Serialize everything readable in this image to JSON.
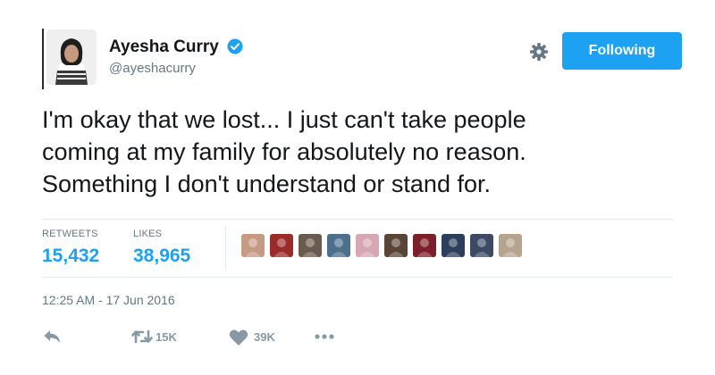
{
  "user": {
    "display_name": "Ayesha Curry",
    "handle": "@ayeshacurry",
    "verified": true,
    "avatar_icon": "profile-photo"
  },
  "follow_button": {
    "label": "Following",
    "color": "#1da1f2"
  },
  "settings": {
    "icon": "gear-icon"
  },
  "tweet": {
    "lines": [
      "I'm okay that we lost... I just can't take people",
      "coming at my family for absolutely no reason.",
      "Something I don't understand or stand for."
    ]
  },
  "stats": {
    "retweets_label": "RETWEETS",
    "retweets_value": "15,432",
    "likes_label": "LIKES",
    "likes_value": "38,965"
  },
  "likers": [
    {
      "name": "liker-avatar-1",
      "color": "#c79a86"
    },
    {
      "name": "liker-avatar-2",
      "color": "#9b2a2a"
    },
    {
      "name": "liker-avatar-3",
      "color": "#6b5a4e"
    },
    {
      "name": "liker-avatar-4",
      "color": "#4b6f8c"
    },
    {
      "name": "liker-avatar-5",
      "color": "#d7a7b3"
    },
    {
      "name": "liker-avatar-6",
      "color": "#5a4438"
    },
    {
      "name": "liker-avatar-7",
      "color": "#7d1f2a"
    },
    {
      "name": "liker-avatar-8",
      "color": "#2c3e5c"
    },
    {
      "name": "liker-avatar-9",
      "color": "#3d4a66"
    },
    {
      "name": "liker-avatar-10",
      "color": "#b7a48e"
    }
  ],
  "timestamp": "12:25 AM - 17 Jun 2016",
  "actions": {
    "retweet_count": "15K",
    "like_count": "39K"
  },
  "colors": {
    "accent": "#1da1f2",
    "muted": "#657786",
    "action_gray": "#8899a6",
    "divider": "#e1e8ed"
  }
}
